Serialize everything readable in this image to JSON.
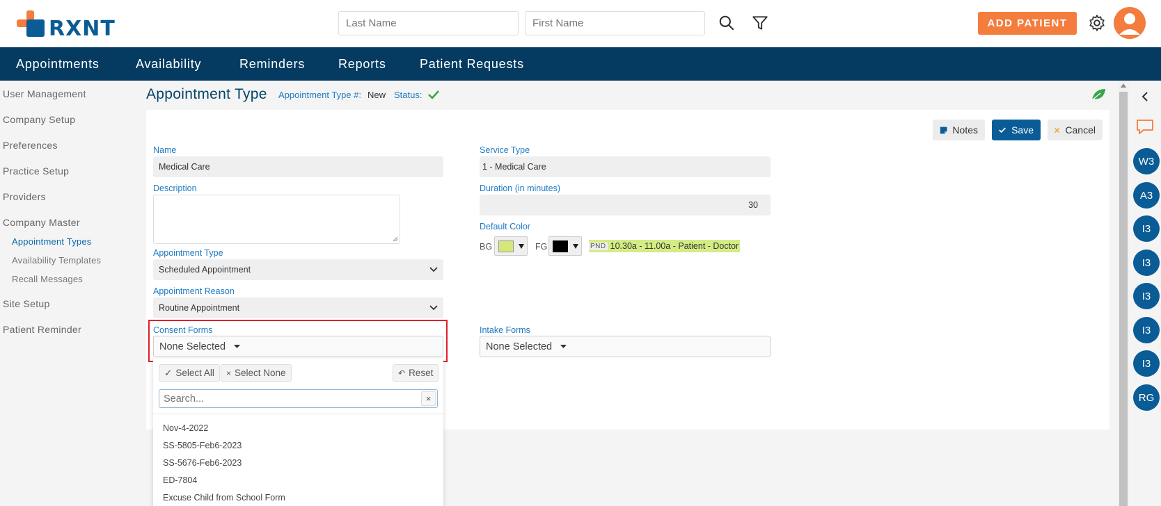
{
  "app": {
    "logo_text": "RXNT"
  },
  "header": {
    "last_name_placeholder": "Last Name",
    "first_name_placeholder": "First Name",
    "add_patient_label": "ADD PATIENT"
  },
  "nav": {
    "items": [
      "Appointments",
      "Availability",
      "Reminders",
      "Reports",
      "Patient Requests"
    ]
  },
  "sidebar": {
    "items": [
      "User Management",
      "Company Setup",
      "Preferences",
      "Practice Setup",
      "Providers",
      "Company Master",
      "Site Setup",
      "Patient Reminder"
    ],
    "subitems": [
      "Appointment Types",
      "Availability Templates",
      "Recall Messages"
    ]
  },
  "page": {
    "title": "Appointment Type",
    "type_num_label": "Appointment Type #:",
    "type_num_value": "New",
    "status_label": "Status:"
  },
  "toolbar": {
    "notes_label": "Notes",
    "save_label": "Save",
    "cancel_label": "Cancel"
  },
  "form": {
    "name_label": "Name",
    "name_value": "Medical Care",
    "description_label": "Description",
    "appt_type_label": "Appointment Type",
    "appt_type_value": "Scheduled Appointment",
    "appt_reason_label": "Appointment Reason",
    "appt_reason_value": "Routine Appointment",
    "consent_label": "Consent Forms",
    "consent_value": "None Selected",
    "service_type_label": "Service Type",
    "service_type_value": "1 - Medical Care",
    "duration_label": "Duration (in minutes)",
    "duration_value": "30",
    "default_color_label": "Default Color",
    "bg_label": "BG",
    "fg_label": "FG",
    "preview_tag": "PND",
    "preview_text": "10.30a - 11.00a - Patient - Doctor",
    "intake_label": "Intake Forms",
    "intake_value": "None Selected"
  },
  "dropdown": {
    "select_all_label": "Select All",
    "select_none_label": "Select None",
    "reset_label": "Reset",
    "search_placeholder": "Search...",
    "options": [
      "Nov-4-2022",
      "SS-5805-Feb6-2023",
      "SS-5676-Feb6-2023",
      "ED-7804",
      "Excuse Child from School Form"
    ]
  },
  "rightbar": {
    "badges": [
      "W3",
      "A3",
      "I3",
      "I3",
      "I3",
      "I3",
      "I3",
      "RG"
    ]
  },
  "colors": {
    "navy": "#053b61",
    "orange": "#f47c3c",
    "primary": "#0a5c96",
    "bg_swatch": "#d4e87a",
    "fg_swatch": "#000000",
    "preview_bg": "#d4ec84"
  }
}
